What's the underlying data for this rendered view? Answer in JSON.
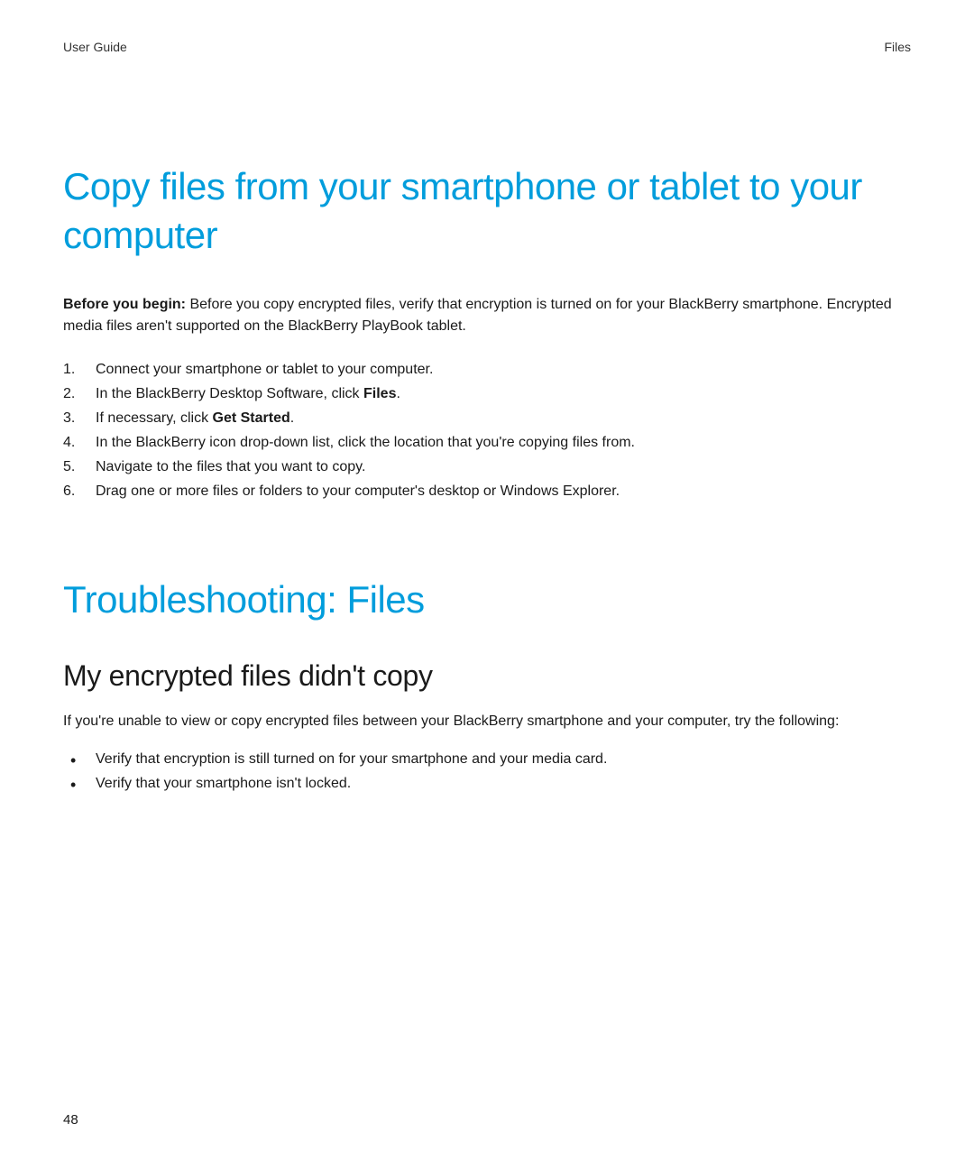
{
  "header": {
    "left": "User Guide",
    "right": "Files"
  },
  "title1": "Copy files from your smartphone or tablet to your computer",
  "intro": {
    "lead": "Before you begin: ",
    "rest": "Before you copy encrypted files, verify that encryption is turned on for your BlackBerry smartphone. Encrypted media files aren't supported on the BlackBerry PlayBook tablet."
  },
  "steps": [
    {
      "text": "Connect your smartphone or tablet to your computer."
    },
    {
      "pre": "In the BlackBerry Desktop Software, click ",
      "bold": "Files",
      "post": "."
    },
    {
      "pre": "If necessary, click ",
      "bold": "Get Started",
      "post": "."
    },
    {
      "text": "In the BlackBerry icon drop-down list, click the location that you're copying files from."
    },
    {
      "text": "Navigate to the files that you want to copy."
    },
    {
      "text": "Drag one or more files or folders to your computer's desktop or Windows Explorer."
    }
  ],
  "title2": "Troubleshooting: Files",
  "subtitle": "My encrypted files didn't copy",
  "para": "If you're unable to view or copy encrypted files between your BlackBerry smartphone and your computer, try the following:",
  "bullets": [
    "Verify that encryption is still turned on for your smartphone and your media card.",
    "Verify that your smartphone isn't locked."
  ],
  "pageNumber": "48"
}
